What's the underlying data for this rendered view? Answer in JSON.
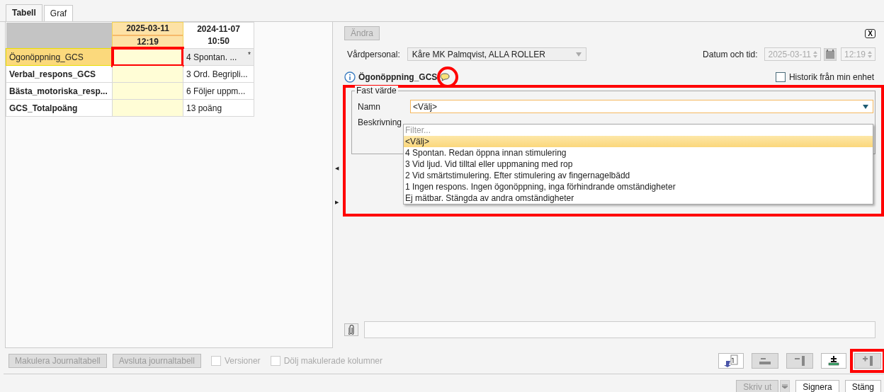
{
  "tabs": [
    {
      "label": "Tabell",
      "selected": true
    },
    {
      "label": "Graf",
      "selected": false
    }
  ],
  "table": {
    "columns": [
      {
        "date": "2025-03-11",
        "time": "12:19",
        "selected": true
      },
      {
        "date": "2024-11-07",
        "time": "10:50",
        "selected": false
      }
    ],
    "rows": [
      {
        "name": "Ögonöppning_GCS",
        "selected": true,
        "cells": [
          "",
          "4 Spontan. ..."
        ],
        "marker": "*"
      },
      {
        "name": "Verbal_respons_GCS",
        "selected": false,
        "cells": [
          "",
          "3 Ord. Begripli..."
        ]
      },
      {
        "name": "Bästa_motoriska_resp...",
        "selected": false,
        "cells": [
          "",
          "6 Följer uppm..."
        ]
      },
      {
        "name": "GCS_Totalpoäng",
        "selected": false,
        "cells": [
          "",
          "13 poäng"
        ]
      }
    ]
  },
  "splitter": {
    "left_arrow": "◀",
    "right_arrow": "▶"
  },
  "form": {
    "edit_button": "Ändra",
    "close_label": "X",
    "staff_label": "Vårdpersonal:",
    "staff_value": "Kåre MK Palmqvist, ALLA ROLLER",
    "datetime_label": "Datum och tid:",
    "date_value": "2025-03-11",
    "time_value": "12:19",
    "term_title": "Ögonöppning_GCS",
    "history_label": "Historik från min enhet",
    "history_checked": false,
    "group_title": "Fast värde",
    "name_label": "Namn",
    "name_value": "<Välj>",
    "description_label": "Beskrivning",
    "dropdown": {
      "placeholder": "Filter...",
      "options": [
        {
          "label": "<Välj>",
          "selected": true
        },
        {
          "label": "4 Spontan. Redan öppna innan stimulering",
          "selected": false
        },
        {
          "label": "3 Vid ljud. Vid tilltal eller uppmaning med rop",
          "selected": false
        },
        {
          "label": "2 Vid smärtstimulering. Efter stimulering av fingernagelbädd",
          "selected": false
        },
        {
          "label": "1 Ingen respons. Ingen ögonöppning, inga förhindrande omständigheter",
          "selected": false
        },
        {
          "label": "Ej mätbar. Stängda av andra omständigheter",
          "selected": false
        }
      ]
    }
  },
  "bottom_left": {
    "buttons": [
      "Makulera Journaltabell",
      "Avsluta journaltabell"
    ],
    "checkboxes": [
      {
        "label": "Versioner",
        "checked": false
      },
      {
        "label": "Dölj makulerade kolumner",
        "checked": false
      }
    ]
  },
  "footer": {
    "print": "Skriv ut",
    "buttons": [
      "Signera",
      "Stäng"
    ]
  }
}
